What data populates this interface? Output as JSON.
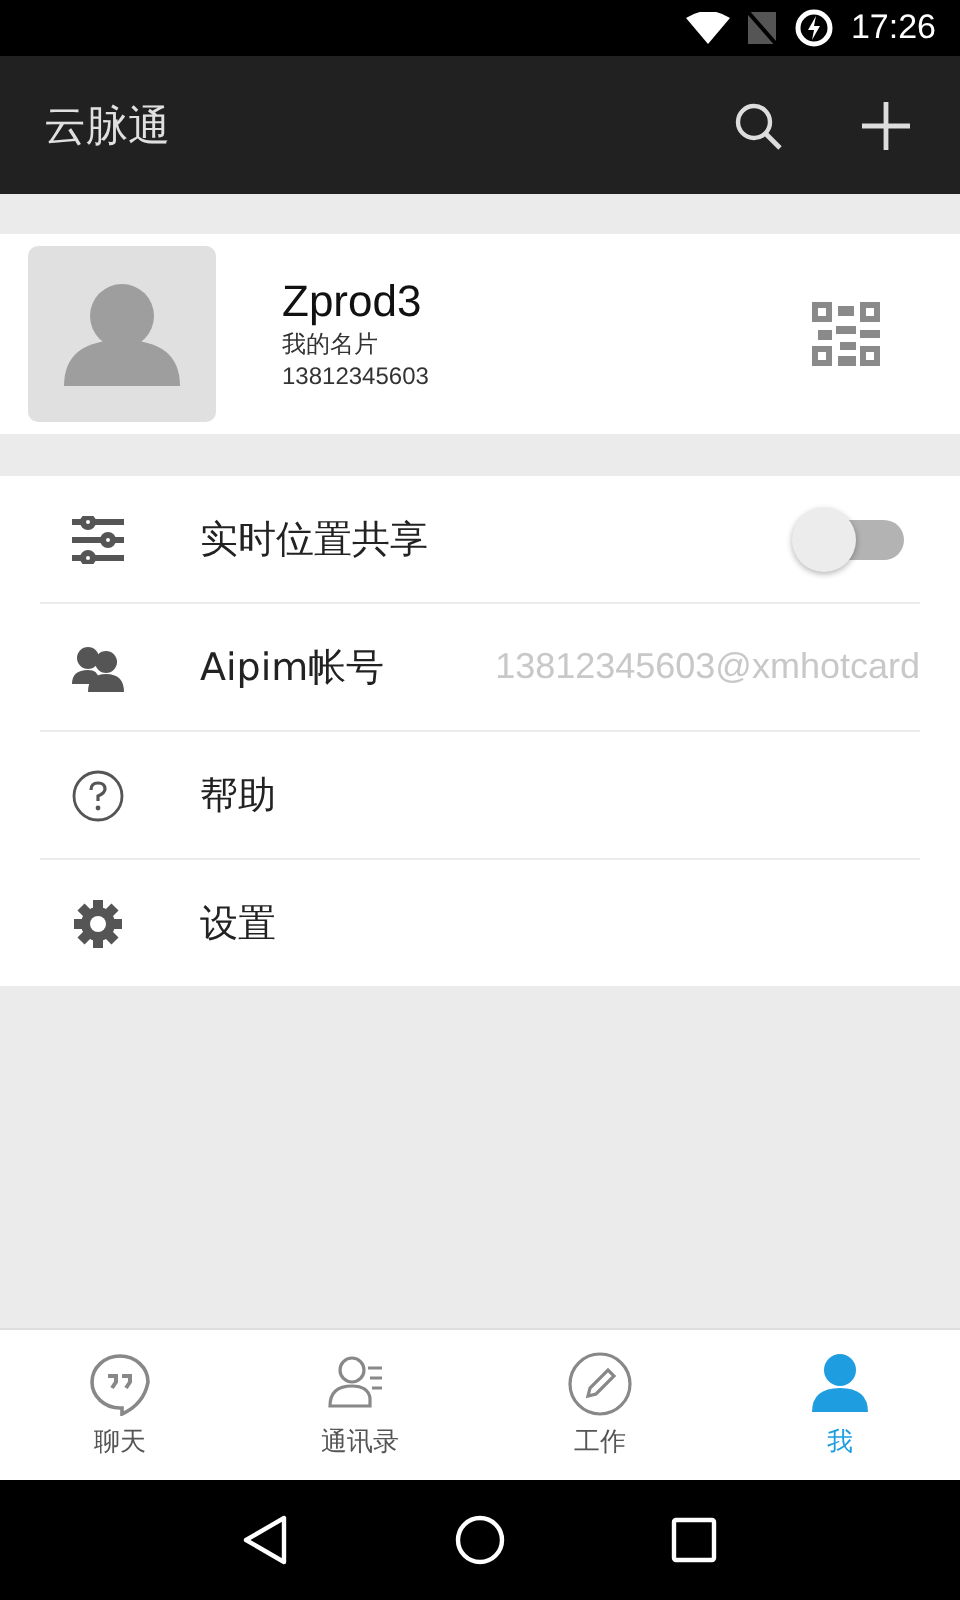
{
  "status_bar": {
    "time": "17:26"
  },
  "app_bar": {
    "title": "云脉通"
  },
  "profile": {
    "name": "Zprod3",
    "subtitle": "我的名片",
    "phone": "13812345603"
  },
  "menu": [
    {
      "kind": "toggle",
      "label": "实时位置共享",
      "on": false
    },
    {
      "kind": "value",
      "label": "Aipim帐号",
      "value": "13812345603@xmhotcard"
    },
    {
      "kind": "plain",
      "label": "帮助"
    },
    {
      "kind": "plain",
      "label": "设置"
    }
  ],
  "tabs": [
    {
      "label": "聊天",
      "selected": false
    },
    {
      "label": "通讯录",
      "selected": false
    },
    {
      "label": "工作",
      "selected": false
    },
    {
      "label": "我",
      "selected": true
    }
  ]
}
